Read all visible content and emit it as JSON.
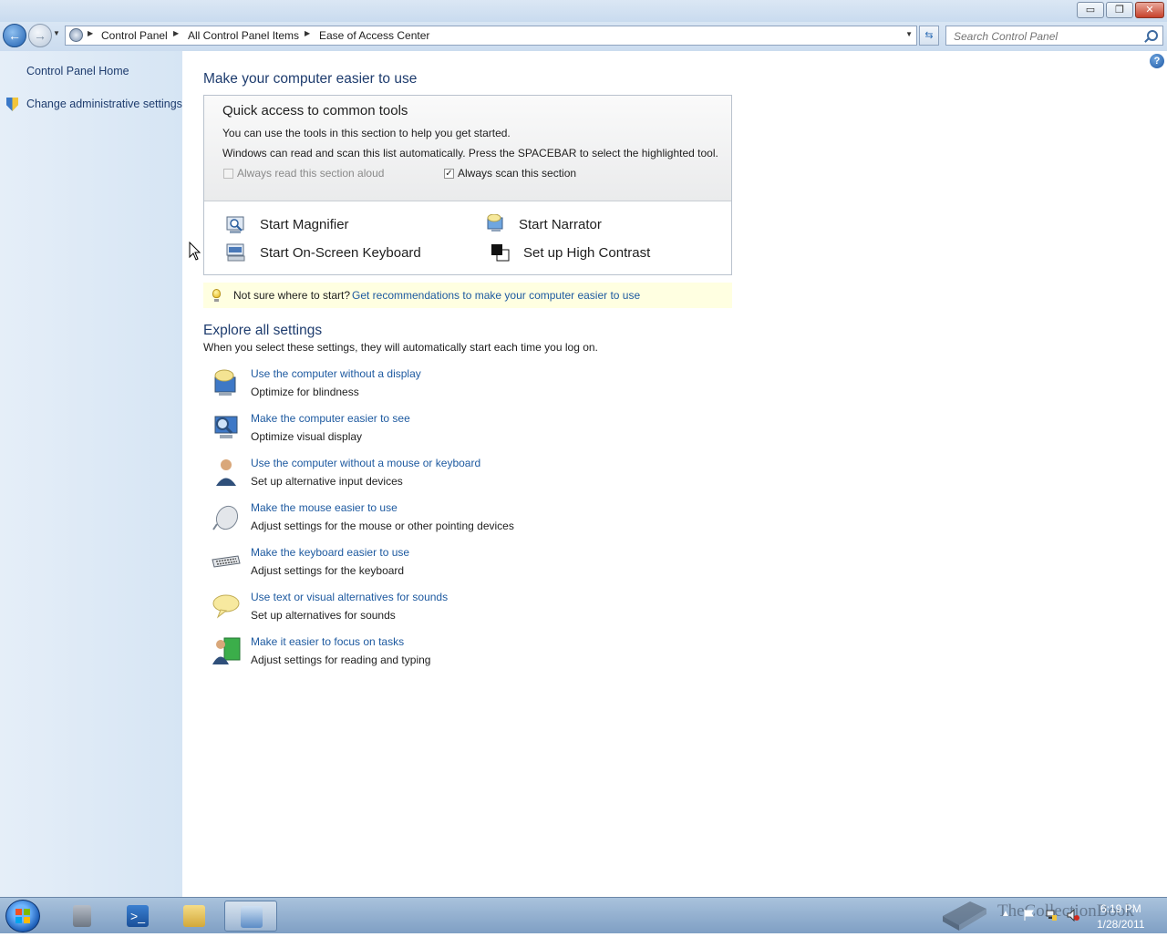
{
  "window": {
    "controls": {
      "minimize": "▭",
      "maximize": "❐",
      "close": "✕"
    }
  },
  "nav": {
    "breadcrumbs": [
      "Control Panel",
      "All Control Panel Items",
      "Ease of Access Center"
    ],
    "search_placeholder": "Search Control Panel"
  },
  "sidebar": {
    "items": [
      {
        "label": "Control Panel Home"
      },
      {
        "label": "Change administrative settings",
        "icon": "shield-icon"
      }
    ]
  },
  "main": {
    "title": "Make your computer easier to use",
    "quick_access": {
      "heading": "Quick access to common tools",
      "line1": "You can use the tools in this section to help you get started.",
      "line2": "Windows can read and scan this list automatically.  Press the SPACEBAR to select the highlighted tool.",
      "checkbox_read_aloud": {
        "label": "Always read this section aloud",
        "checked": false,
        "enabled": false
      },
      "checkbox_scan": {
        "label": "Always scan this section",
        "checked": true,
        "enabled": true
      },
      "tools": [
        {
          "label": "Start Magnifier",
          "icon": "magnifier-icon"
        },
        {
          "label": "Start Narrator",
          "icon": "narrator-icon"
        },
        {
          "label": "Start On-Screen Keyboard",
          "icon": "onscreen-keyboard-icon"
        },
        {
          "label": "Set up High Contrast",
          "icon": "high-contrast-icon"
        }
      ]
    },
    "recommendation": {
      "text": "Not sure where to start?",
      "link": "Get recommendations to make your computer easier to use"
    },
    "explore": {
      "title": "Explore all settings",
      "description": "When you select these settings, they will automatically start each time you log on.",
      "settings": [
        {
          "link": "Use the computer without a display",
          "desc": "Optimize for blindness",
          "icon": "display-speech-icon"
        },
        {
          "link": "Make the computer easier to see",
          "desc": "Optimize visual display",
          "icon": "monitor-magnify-icon"
        },
        {
          "link": "Use the computer without a mouse or keyboard",
          "desc": "Set up alternative input devices",
          "icon": "person-input-icon"
        },
        {
          "link": "Make the mouse easier to use",
          "desc": "Adjust settings for the mouse or other pointing devices",
          "icon": "mouse-icon"
        },
        {
          "link": "Make the keyboard easier to use",
          "desc": "Adjust settings for the keyboard",
          "icon": "keyboard-icon"
        },
        {
          "link": "Use text or visual alternatives for sounds",
          "desc": "Set up alternatives for sounds",
          "icon": "speech-bubble-icon"
        },
        {
          "link": "Make it easier to focus on tasks",
          "desc": "Adjust settings for reading and typing",
          "icon": "focus-tasks-icon"
        }
      ]
    }
  },
  "taskbar": {
    "clock_time": "6:19 PM",
    "clock_date": "1/28/2011",
    "watermark": "TheCollectionBook"
  },
  "colors": {
    "link": "#1e5aa0",
    "heading": "#1e3c6e",
    "sidebar_bg": "#dce8f5",
    "recommendation_bg": "#ffffe1"
  }
}
